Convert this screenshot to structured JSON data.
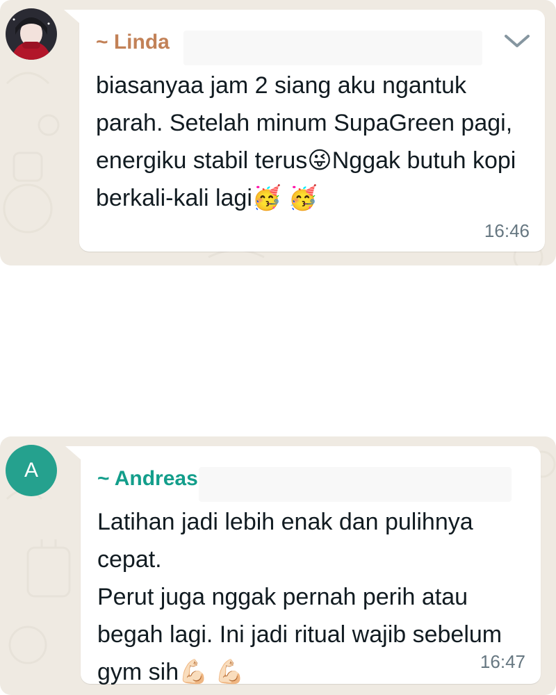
{
  "messages": [
    {
      "sender": "~ Linda",
      "text": "biasanyaa jam 2 siang aku ngantuk parah. Setelah minum SupaGreen pagi, energiku stabil terus",
      "text_after": "Nggak butuh kopi berkali-kali lagi",
      "emoji_1": "😜",
      "emoji_2": "🥳",
      "emoji_3": "🥳",
      "time": "16:46"
    },
    {
      "sender": "~ Andreas",
      "avatar_initial": "A",
      "line_1": "Latihan jadi lebih enak dan pulihnya cepat.",
      "line_2": "Perut juga nggak pernah perih atau begah lagi. Ini jadi ritual wajib sebelum gym sih",
      "emoji_1": "💪🏻",
      "emoji_2": "💪🏻",
      "time": "16:47"
    }
  ],
  "colors": {
    "chat_background": "#efeae2",
    "bubble": "#ffffff",
    "sender_linda": "#c28157",
    "sender_andreas": "#139e8b",
    "avatar_andreas": "#25a18e",
    "timestamp": "#667781"
  }
}
